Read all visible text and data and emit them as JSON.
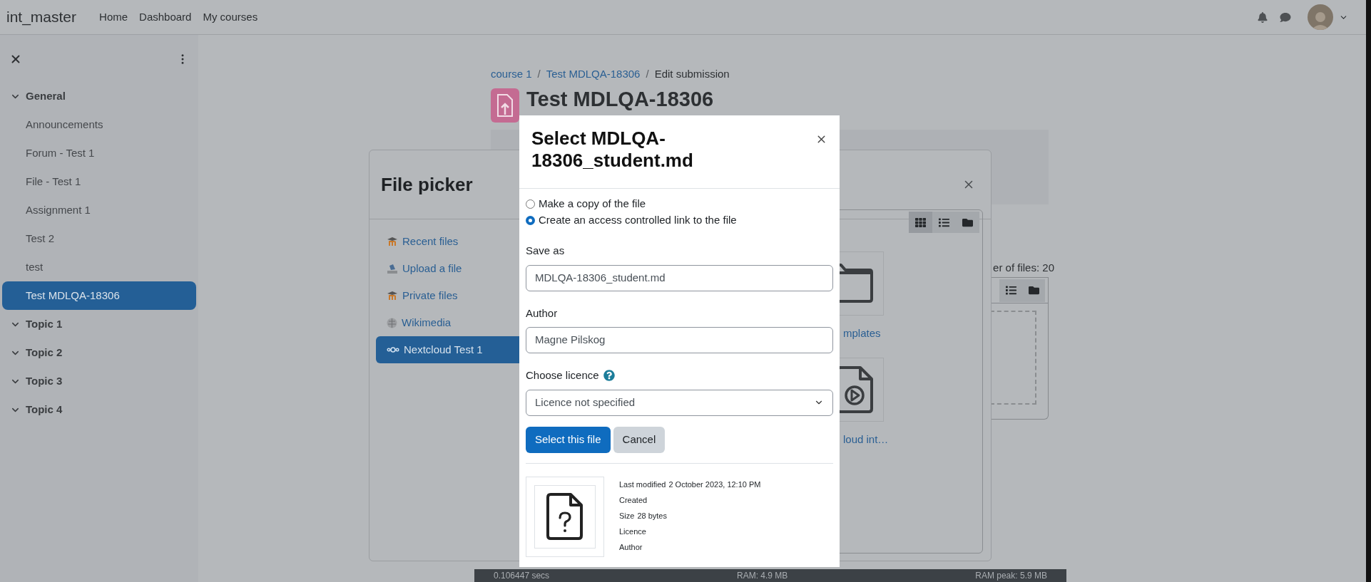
{
  "topbar": {
    "site_name": "int_master",
    "nav": [
      {
        "label": "Home"
      },
      {
        "label": "Dashboard"
      },
      {
        "label": "My courses"
      }
    ]
  },
  "sidebar": {
    "sections": [
      {
        "title": "General",
        "expanded": true,
        "children": [
          {
            "label": "Announcements",
            "selected": false
          },
          {
            "label": "Forum - Test 1",
            "selected": false
          },
          {
            "label": "File - Test 1",
            "selected": false
          },
          {
            "label": "Assignment 1",
            "selected": false
          },
          {
            "label": "Test 2",
            "selected": false
          },
          {
            "label": "test",
            "selected": false
          },
          {
            "label": "Test MDLQA-18306",
            "selected": true
          }
        ]
      },
      {
        "title": "Topic 1",
        "expanded": true
      },
      {
        "title": "Topic 2",
        "expanded": true
      },
      {
        "title": "Topic 3",
        "expanded": true
      },
      {
        "title": "Topic 4",
        "expanded": true
      }
    ]
  },
  "page": {
    "breadcrumb_separator": "/",
    "breadcrumb": [
      {
        "label": "course 1",
        "link": true
      },
      {
        "label": "Test MDLQA-18306",
        "link": true
      },
      {
        "label": "Edit submission",
        "link": false
      }
    ],
    "title": "Test MDLQA-18306",
    "files_count": "er of files: 20",
    "view_buttons": [
      {
        "kind": "list",
        "selected": false
      },
      {
        "kind": "tree",
        "selected": false
      }
    ]
  },
  "file_picker": {
    "title": "File picker",
    "repositories": [
      {
        "label": "Recent files",
        "kind": "moodle",
        "selected": false
      },
      {
        "label": "Upload a file",
        "kind": "upload",
        "selected": false
      },
      {
        "label": "Private files",
        "kind": "moodle",
        "selected": false
      },
      {
        "label": "Wikimedia",
        "kind": "wiki",
        "selected": false
      },
      {
        "label": "Nextcloud Test 1",
        "kind": "cloud",
        "selected": true
      }
    ],
    "view_buttons": [
      {
        "kind": "grid",
        "selected": true
      },
      {
        "kind": "list",
        "selected": false
      },
      {
        "kind": "tree",
        "selected": false
      }
    ],
    "files": [
      {
        "kind": "folder",
        "name": "mplates"
      },
      {
        "kind": "video",
        "name": "loud int…"
      }
    ]
  },
  "dialog": {
    "title": "Select MDLQA-18306_student.md",
    "options": [
      {
        "label": "Make a copy of the file",
        "selected": false
      },
      {
        "label": "Create an access controlled link to the file",
        "selected": true
      }
    ],
    "save_as": {
      "label": "Save as",
      "value": "MDLQA-18306_student.md"
    },
    "author": {
      "label": "Author",
      "value": "Magne Pilskog"
    },
    "licence": {
      "label": "Choose licence",
      "value": "Licence not specified"
    },
    "buttons": [
      {
        "label": "Select this file",
        "kind": "primary"
      },
      {
        "label": "Cancel",
        "kind": "secondary"
      }
    ],
    "details": [
      {
        "label": "Last modified",
        "value": "2 October 2023, 12:10 PM"
      },
      {
        "label": "Created"
      },
      {
        "label": "Size",
        "value": "28 bytes"
      },
      {
        "label": "Licence"
      },
      {
        "label": "Author"
      }
    ]
  },
  "footer": [
    "0.106447 secs",
    "RAM: 4.9 MB",
    "RAM peak: 5.9 MB"
  ]
}
